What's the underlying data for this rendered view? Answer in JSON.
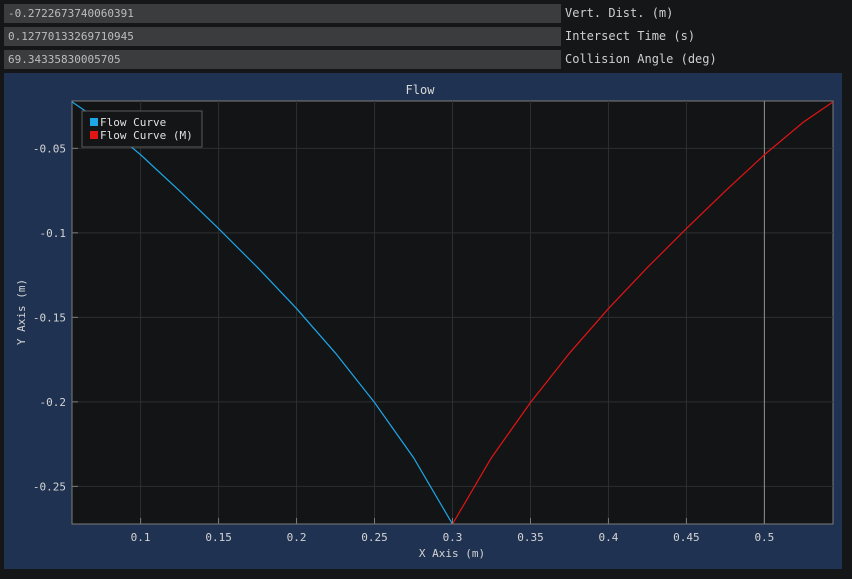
{
  "fields": [
    {
      "value": "-0.2722673740060391",
      "label": "Vert. Dist. (m)"
    },
    {
      "value": "0.12770133269710945",
      "label": "Intersect Time (s)"
    },
    {
      "value": "69.34335830005705",
      "label": "Collision Angle (deg)"
    }
  ],
  "colors": {
    "series_blue": "#1da7e7",
    "series_red": "#e31414",
    "plot_background": "#131416",
    "frame_background": "#1f3251"
  },
  "chart_data": {
    "type": "line",
    "title": "Flow",
    "xlabel": "X Axis (m)",
    "ylabel": "Y Axis (m)",
    "xlim": [
      0.056,
      0.544
    ],
    "ylim": [
      -0.2722673740060391,
      -0.022
    ],
    "grid": true,
    "legend_position": "top-left",
    "x_ticks": [
      0.1,
      0.15,
      0.2,
      0.25,
      0.3,
      0.35,
      0.4,
      0.45,
      0.5
    ],
    "x_tick_labels": [
      "0.1",
      "0.15",
      "0.2",
      "0.25",
      "0.3",
      "0.35",
      "0.4",
      "0.45",
      "0.5"
    ],
    "y_ticks": [
      -0.05,
      -0.1,
      -0.15,
      -0.2,
      -0.25
    ],
    "y_tick_labels": [
      "-0.05",
      "-0.1",
      "-0.15",
      "-0.2",
      "-0.25"
    ],
    "vertical_marker_x": 0.5,
    "series": [
      {
        "name": "Flow Curve",
        "color": "#1da7e7",
        "x": [
          0.056,
          0.075,
          0.1,
          0.125,
          0.15,
          0.175,
          0.2,
          0.225,
          0.25,
          0.275,
          0.3
        ],
        "y": [
          -0.0225,
          -0.0345,
          -0.0538,
          -0.0752,
          -0.0975,
          -0.1205,
          -0.1448,
          -0.1712,
          -0.2004,
          -0.233,
          -0.2723
        ]
      },
      {
        "name": "Flow Curve (M)",
        "color": "#e31414",
        "x": [
          0.3,
          0.325,
          0.35,
          0.375,
          0.4,
          0.425,
          0.45,
          0.475,
          0.5,
          0.525,
          0.544
        ],
        "y": [
          -0.2723,
          -0.233,
          -0.2004,
          -0.1712,
          -0.1448,
          -0.1205,
          -0.0975,
          -0.0752,
          -0.0538,
          -0.0345,
          -0.0225
        ]
      }
    ]
  }
}
